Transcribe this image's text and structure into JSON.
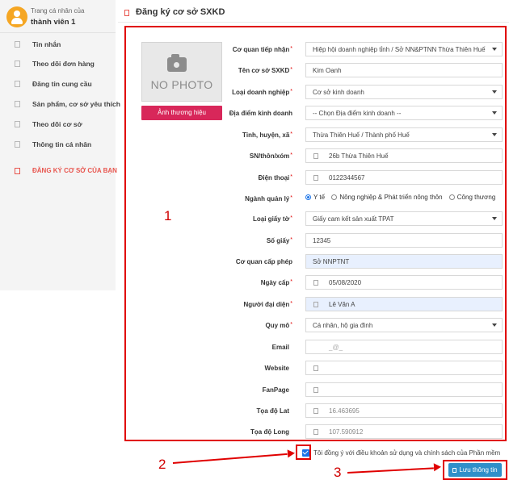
{
  "sidebar": {
    "profile_subtitle": "Trang cá nhân của",
    "profile_name": "thành viên 1",
    "items": [
      {
        "label": "Tin nhắn"
      },
      {
        "label": "Theo dõi đơn hàng"
      },
      {
        "label": "Đăng tin cung cầu"
      },
      {
        "label": "Sản phẩm, cơ sở yêu thích"
      },
      {
        "label": "Theo dõi cơ sở"
      },
      {
        "label": "Thông tin cá nhân"
      },
      {
        "label": "ĐĂNG KÝ CƠ SỞ CỦA BẠN"
      }
    ]
  },
  "page": {
    "title": "Đăng ký cơ sở SXKD"
  },
  "photo": {
    "placeholder": "NO PHOTO",
    "button_label": "Ảnh thương hiệu"
  },
  "form": {
    "co_quan_tiep_nhan": {
      "label": "Cơ quan tiếp nhận",
      "value": "Hiệp hội doanh nghiệp tỉnh / Sở NN&PTNN Thừa Thiên Huế"
    },
    "ten_co_so": {
      "label": "Tên cơ sở SXKD",
      "value": "Kim Oanh"
    },
    "loai_doanh_nghiep": {
      "label": "Loại doanh nghiệp",
      "value": "Cơ sở kinh doanh"
    },
    "dia_diem": {
      "label": "Địa điểm kinh doanh",
      "value": "-- Chọn Địa điểm kinh doanh --"
    },
    "tinh_huyen_xa": {
      "label": "Tỉnh, huyện, xã",
      "value": "Thừa Thiên Huế / Thành phố Huế"
    },
    "sn_thon_xom": {
      "label": "SN/thôn/xóm",
      "value": "26b Thừa Thiên Huế"
    },
    "dien_thoai": {
      "label": "Điện thoại",
      "value": "0122344567"
    },
    "nganh_quan_ly": {
      "label": "Ngành quản lý",
      "options": [
        "Y tế",
        "Nông nghiệp & Phát triển nông thôn",
        "Công thương"
      ],
      "selected": "Y tế"
    },
    "loai_giay_to": {
      "label": "Loại giấy tờ",
      "value": "Giấy cam kết sản xuất TPAT"
    },
    "so_giay": {
      "label": "Số giấy",
      "value": "12345"
    },
    "co_quan_cap_phep": {
      "label": "Cơ quan cấp phép",
      "value": "Sở NNPTNT"
    },
    "ngay_cap": {
      "label": "Ngày cấp",
      "value": "05/08/2020"
    },
    "nguoi_dai_dien": {
      "label": "Người đại diện",
      "value": "Lê Văn A"
    },
    "quy_mo": {
      "label": "Quy mô",
      "value": "Cá nhân, hộ gia đình"
    },
    "email": {
      "label": "Email",
      "placeholder": "_@_"
    },
    "website": {
      "label": "Website",
      "value": ""
    },
    "fanpage": {
      "label": "FanPage",
      "value": ""
    },
    "toa_do_lat": {
      "label": "Tọa độ Lat",
      "value": "16.463695"
    },
    "toa_do_long": {
      "label": "Tọa độ Long",
      "value": "107.590912"
    }
  },
  "agreement": {
    "text": "Tôi đồng ý với điều khoản sử dụng và chính sách của Phần mềm",
    "checked": true
  },
  "actions": {
    "save_label": "Lưu thông tin"
  },
  "annotations": {
    "one": "1",
    "two": "2",
    "three": "3"
  },
  "colors": {
    "annotation_red": "#e00000",
    "accent_pink": "#d8275a",
    "primary_blue": "#2f8fc9",
    "active_nav": "#e8554e"
  }
}
